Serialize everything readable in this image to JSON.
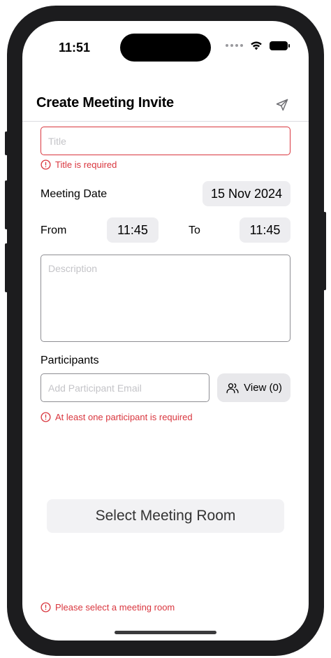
{
  "status_bar": {
    "time": "11:51"
  },
  "nav": {
    "title": "Create Meeting Invite",
    "send_icon": "paper-plane-icon"
  },
  "form": {
    "title_placeholder": "Title",
    "title_error": "Title is required",
    "meeting_date_label": "Meeting Date",
    "meeting_date_value": "15 Nov 2024",
    "from_label": "From",
    "from_time": "11:45",
    "to_label": "To",
    "to_time": "11:45",
    "description_placeholder": "Description",
    "participants_label": "Participants",
    "participant_email_placeholder": "Add Participant Email",
    "view_button_label": "View (0)",
    "participants_error": "At least one participant is required",
    "select_room_label": "Select Meeting Room",
    "room_error": "Please select a meeting room"
  },
  "colors": {
    "error": "#d9363e",
    "pill_bg": "#ededf0",
    "border": "#8e8e93"
  }
}
